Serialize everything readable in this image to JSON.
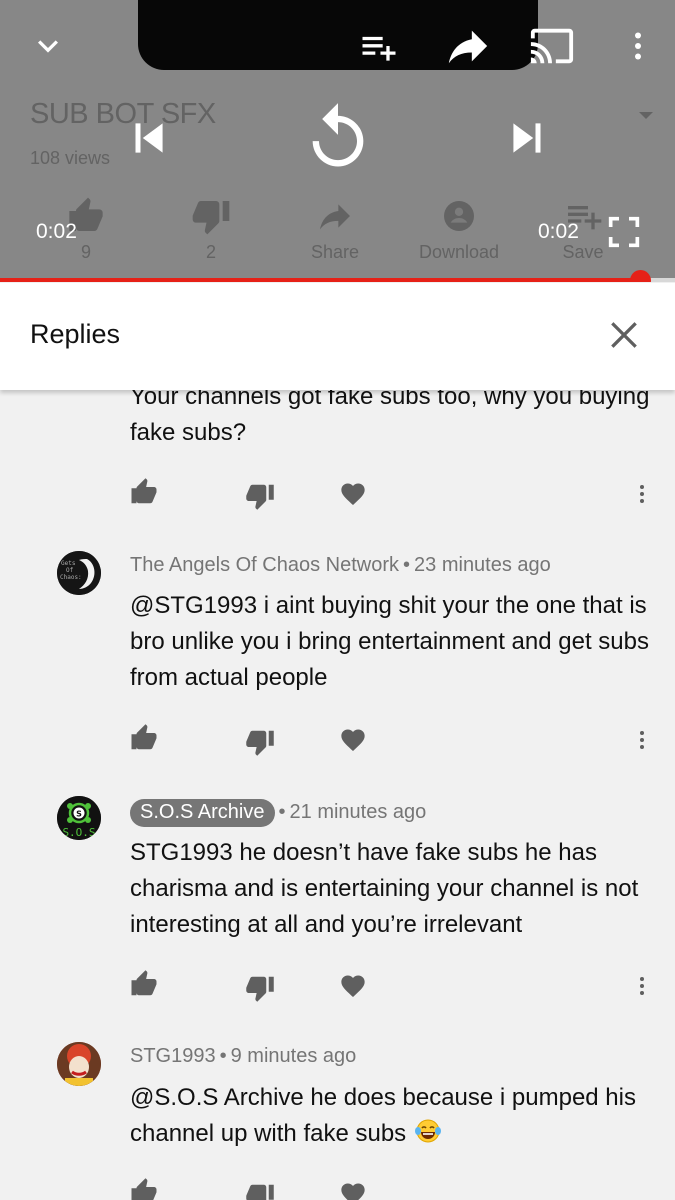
{
  "player": {
    "video_title": "SUB BOT SFX",
    "views": "108 views",
    "current_time": "0:02",
    "duration": "0:02",
    "progress": 1.0,
    "background_actions": [
      {
        "label": "9",
        "icon": "thumbs-up-icon"
      },
      {
        "label": "2",
        "icon": "thumbs-down-icon"
      },
      {
        "label": "Share",
        "icon": "share-icon"
      },
      {
        "label": "Download",
        "icon": "download-icon"
      },
      {
        "label": "Save",
        "icon": "save-to-playlist-icon"
      }
    ],
    "top_icons": [
      "chevron-down-icon",
      "add-to-queue-icon",
      "share-icon",
      "cast-icon",
      "more-vert-icon"
    ],
    "center_icons": [
      "previous-icon",
      "replay-icon",
      "next-icon"
    ],
    "accent_color": "#e62117"
  },
  "replies_panel": {
    "title": "Replies",
    "close_icon": "close-icon"
  },
  "comments": [
    {
      "author": "",
      "time": "",
      "text": "Your channels got fake subs too, why you buying fake subs?"
    },
    {
      "author": "The Angels Of Chaos Network",
      "time": "23 minutes ago",
      "text": "@STG1993 i aint buying shit your the one that is bro unlike you i bring entertainment and get subs from actual people",
      "avatar_text": "Gets Of Chaos: The Stor"
    },
    {
      "author": "S.O.S Archive",
      "author_is_owner": true,
      "time": "21 minutes ago",
      "text": "STG1993 he doesn’t have fake subs he has charisma and is entertaining your channel is not interesting at all and you’re irrelevant",
      "avatar_text": "S.O.S",
      "avatar_letter": "S"
    },
    {
      "author": "STG1993",
      "time": "9 minutes ago",
      "text": "@S.O.S Archive he does because i pumped his channel up with fake subs",
      "emoji": "face-with-tears-of-joy"
    }
  ],
  "separator": "•"
}
